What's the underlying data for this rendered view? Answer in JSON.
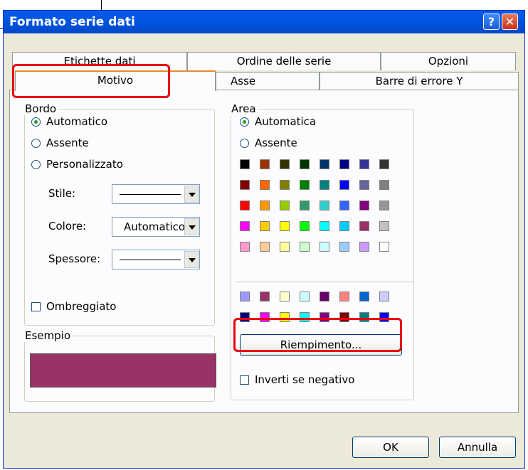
{
  "window": {
    "title": "Formato serie dati",
    "help_glyph": "?",
    "close_glyph": "✕"
  },
  "tabs_back": [
    "Etichette dati",
    "Ordine delle serie",
    "Opzioni"
  ],
  "tabs_front": [
    "Motivo",
    "Asse",
    "Barre di errore Y"
  ],
  "bordo": {
    "title": "Bordo",
    "options": [
      "Automatico",
      "Assente",
      "Personalizzato"
    ],
    "selected": "Automatico",
    "stile_label": "Stile:",
    "colore_label": "Colore:",
    "colore_value": "Automatico",
    "spessore_label": "Spessore:",
    "ombreggiato_label": "Ombreggiato"
  },
  "esempio": {
    "title": "Esempio",
    "color": "#993366"
  },
  "area": {
    "title": "Area",
    "options": [
      "Automatica",
      "Assente"
    ],
    "selected": "Automatica",
    "palette_main": [
      [
        "#000000",
        "#993300",
        "#333300",
        "#003300",
        "#003366",
        "#000080",
        "#333399",
        "#333333"
      ],
      [
        "#800000",
        "#ff6600",
        "#808000",
        "#008000",
        "#008080",
        "#0000ff",
        "#666699",
        "#808080"
      ],
      [
        "#ff0000",
        "#ff9900",
        "#99cc00",
        "#339966",
        "#33cccc",
        "#3366ff",
        "#800080",
        "#969696"
      ],
      [
        "#ff00ff",
        "#ffcc00",
        "#ffff00",
        "#00ff00",
        "#00ffff",
        "#00ccff",
        "#993366",
        "#c0c0c0"
      ],
      [
        "#ff99cc",
        "#ffcc99",
        "#ffff99",
        "#ccffcc",
        "#ccffff",
        "#99ccff",
        "#cc99ff",
        "#ffffff"
      ]
    ],
    "palette_chart": [
      [
        "#9999ff",
        "#993366",
        "#ffffcc",
        "#ccffff",
        "#660066",
        "#ff8080",
        "#0066cc",
        "#ccccff"
      ],
      [
        "#000080",
        "#ff00ff",
        "#ffff00",
        "#00ffff",
        "#800080",
        "#800000",
        "#008080",
        "#0000ff"
      ]
    ],
    "fill_button": "Riempimento...",
    "invert_label": "Inverti se negativo"
  },
  "buttons": {
    "ok": "OK",
    "cancel": "Annulla"
  }
}
